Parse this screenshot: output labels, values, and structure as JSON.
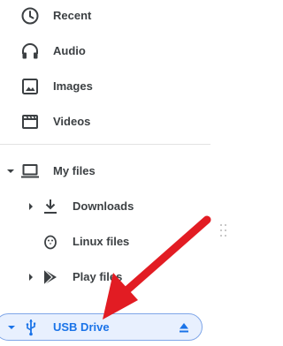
{
  "nav": {
    "recent": {
      "label": "Recent",
      "icon": "clock-icon"
    },
    "audio": {
      "label": "Audio",
      "icon": "headphones-icon"
    },
    "images": {
      "label": "Images",
      "icon": "image-icon"
    },
    "videos": {
      "label": "Videos",
      "icon": "film-icon"
    }
  },
  "tree": {
    "my_files": {
      "label": "My files",
      "icon": "laptop-icon",
      "expanded": true
    },
    "downloads": {
      "label": "Downloads",
      "icon": "download-icon"
    },
    "linux_files": {
      "label": "Linux files",
      "icon": "penguin-icon"
    },
    "play_files": {
      "label": "Play files",
      "icon": "play-store-icon"
    },
    "usb_drive": {
      "label": "USB Drive",
      "icon": "usb-icon",
      "selected": true,
      "eject_icon": "eject-icon"
    }
  },
  "colors": {
    "text": "#3c4043",
    "selected_text": "#1a73e8",
    "selected_bg": "#e8f0fe",
    "annotation_arrow": "#e21c23"
  }
}
